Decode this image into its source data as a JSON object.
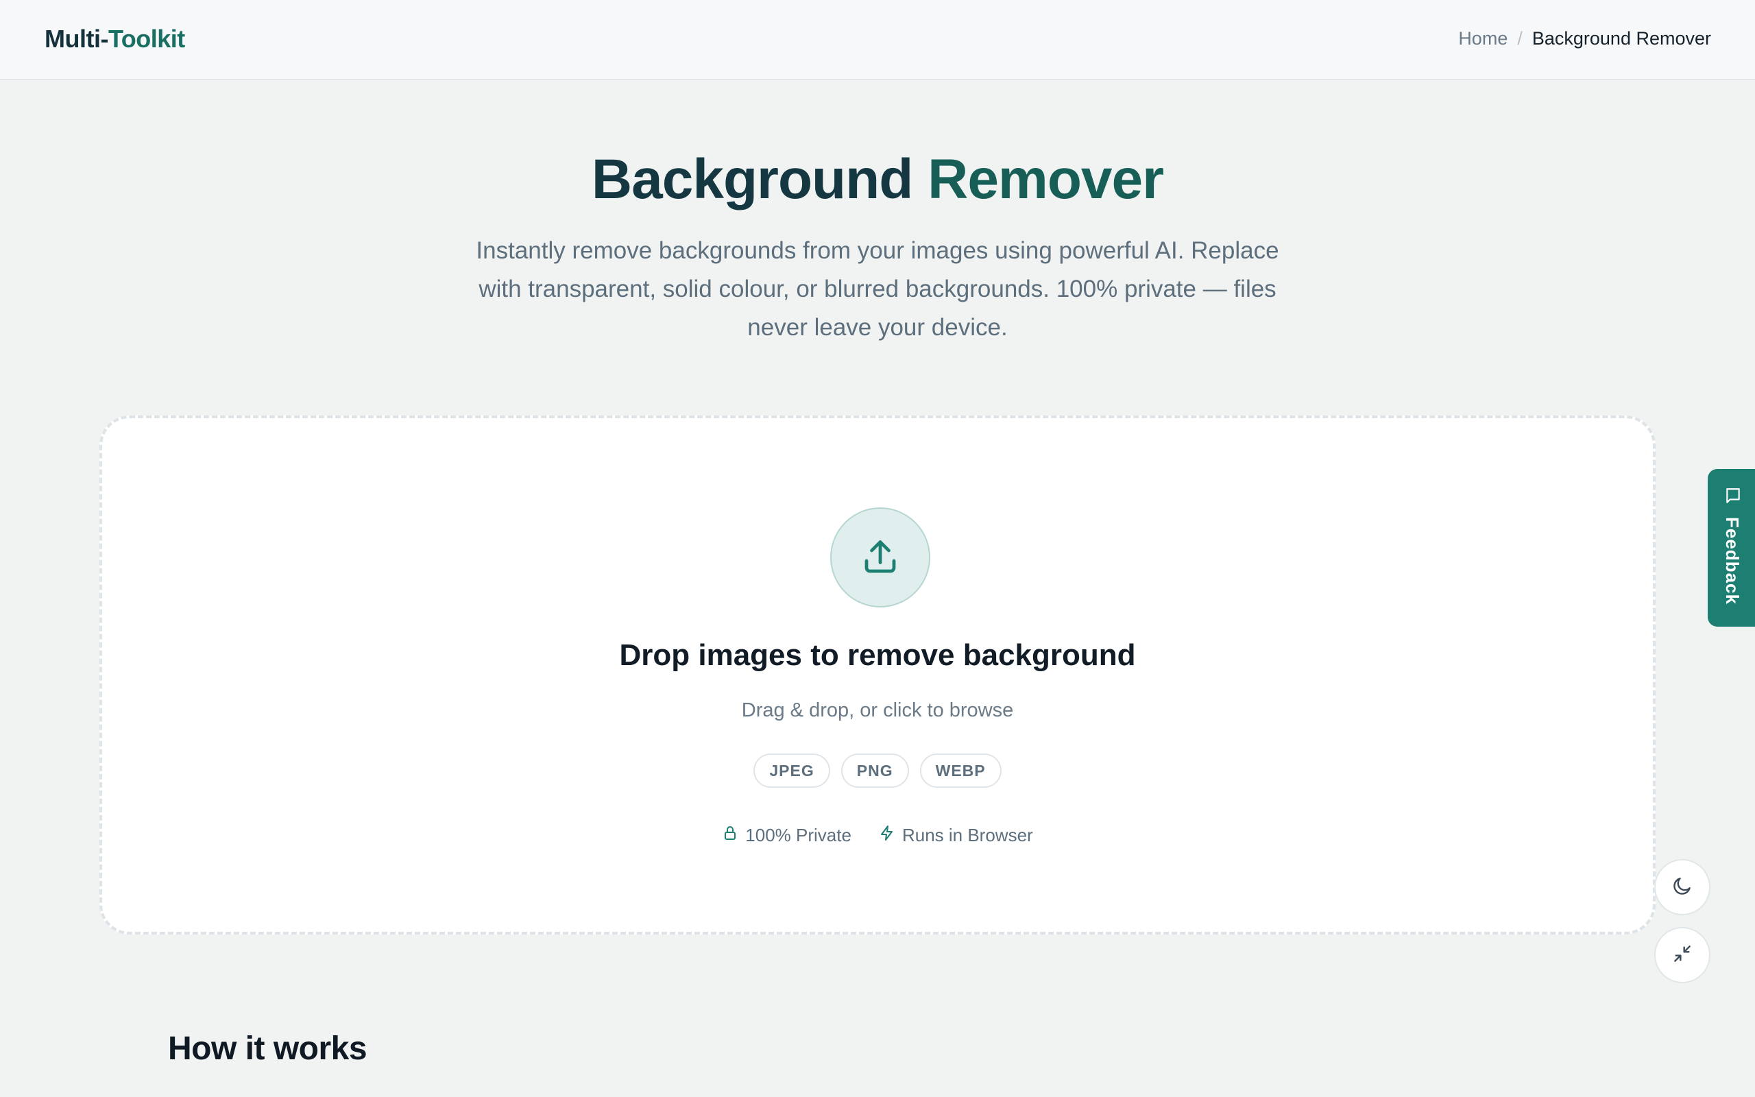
{
  "header": {
    "logo_part1": "Multi-",
    "logo_part2": "Toolkit",
    "breadcrumb": {
      "home": "Home",
      "separator": "/",
      "current": "Background Remover"
    }
  },
  "hero": {
    "title_part1": "Background",
    "title_part2": "Remover",
    "description": "Instantly remove backgrounds from your images using powerful AI. Replace with transparent, solid colour, or blurred backgrounds. 100% private — files never leave your device."
  },
  "dropzone": {
    "icon": "upload-icon",
    "title": "Drop images to remove background",
    "subtitle": "Drag & drop, or click to browse",
    "formats": [
      "JPEG",
      "PNG",
      "WEBP"
    ],
    "badges": [
      {
        "icon": "lock-icon",
        "label": "100% Private"
      },
      {
        "icon": "zap-icon",
        "label": "Runs in Browser"
      }
    ]
  },
  "how_it_works": {
    "title": "How it works"
  },
  "feedback": {
    "icon": "message-square-icon",
    "label": "Feedback"
  },
  "floating_buttons": {
    "theme_icon": "moon-icon",
    "shrink_icon": "minimize-icon"
  },
  "colors": {
    "accent": "#1d7e72",
    "title_dark": "#143742",
    "title_teal": "#175e57",
    "page_bg": "#f0f3f2",
    "muted_text": "#5d6e7c"
  }
}
